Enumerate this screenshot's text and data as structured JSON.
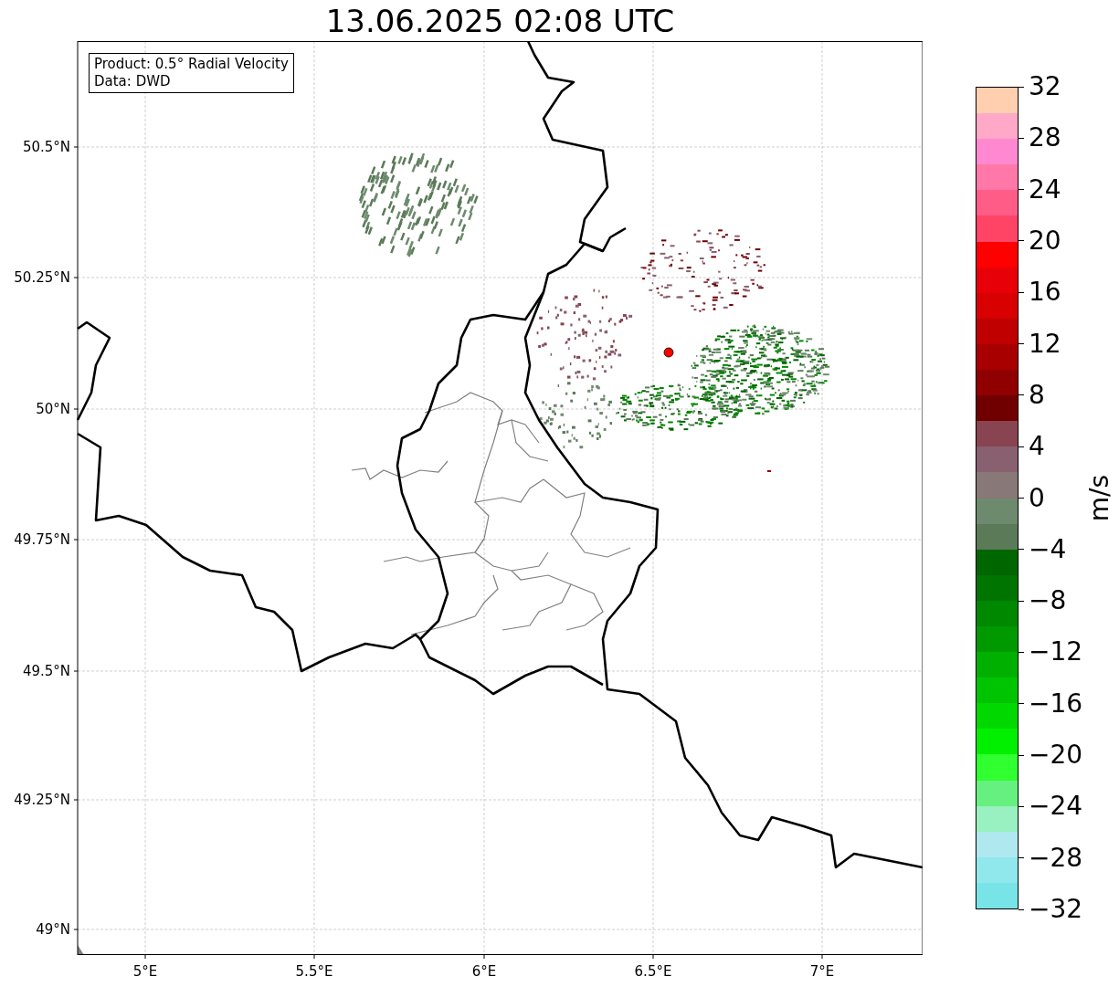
{
  "title": "13.06.2025 02:08 UTC",
  "info_box": {
    "lines": [
      "Product: 0.5° Radial Velocity",
      "Data: DWD"
    ]
  },
  "map": {
    "lat_ticks": [
      "50.5°N",
      "50.25°N",
      "50°N",
      "49.75°N",
      "49.5°N",
      "49.25°N",
      "49°N"
    ],
    "lon_ticks": [
      "5°E",
      "5.5°E",
      "6°E",
      "6.5°E",
      "7°E"
    ]
  },
  "colorbar": {
    "label": "m/s",
    "ticks": [
      "32",
      "28",
      "24",
      "20",
      "16",
      "12",
      "8",
      "4",
      "0",
      "−4",
      "−8",
      "−12",
      "−16",
      "−20",
      "−24",
      "−28",
      "−32"
    ],
    "segments": [
      {
        "color": "#ffcfb0"
      },
      {
        "color": "#ffa8c8"
      },
      {
        "color": "#ff88d0"
      },
      {
        "color": "#ff78a8"
      },
      {
        "color": "#ff5c88"
      },
      {
        "color": "#ff4466"
      },
      {
        "color": "#ff0000"
      },
      {
        "color": "#e80008"
      },
      {
        "color": "#d80000"
      },
      {
        "color": "#c00000"
      },
      {
        "color": "#a80000"
      },
      {
        "color": "#900000"
      },
      {
        "color": "#700000"
      },
      {
        "color": "#884450"
      },
      {
        "color": "#886070"
      },
      {
        "color": "#887878"
      },
      {
        "color": "#6e8a6e"
      },
      {
        "color": "#5a7a58"
      },
      {
        "color": "#006600"
      },
      {
        "color": "#007400"
      },
      {
        "color": "#008800"
      },
      {
        "color": "#009a00"
      },
      {
        "color": "#00b000"
      },
      {
        "color": "#00c400"
      },
      {
        "color": "#00d800"
      },
      {
        "color": "#00f000"
      },
      {
        "color": "#30ff30"
      },
      {
        "color": "#66f080"
      },
      {
        "color": "#99f0c0"
      },
      {
        "color": "#b0e8f0"
      },
      {
        "color": "#90e8ec"
      },
      {
        "color": "#78e4e8"
      }
    ]
  }
}
